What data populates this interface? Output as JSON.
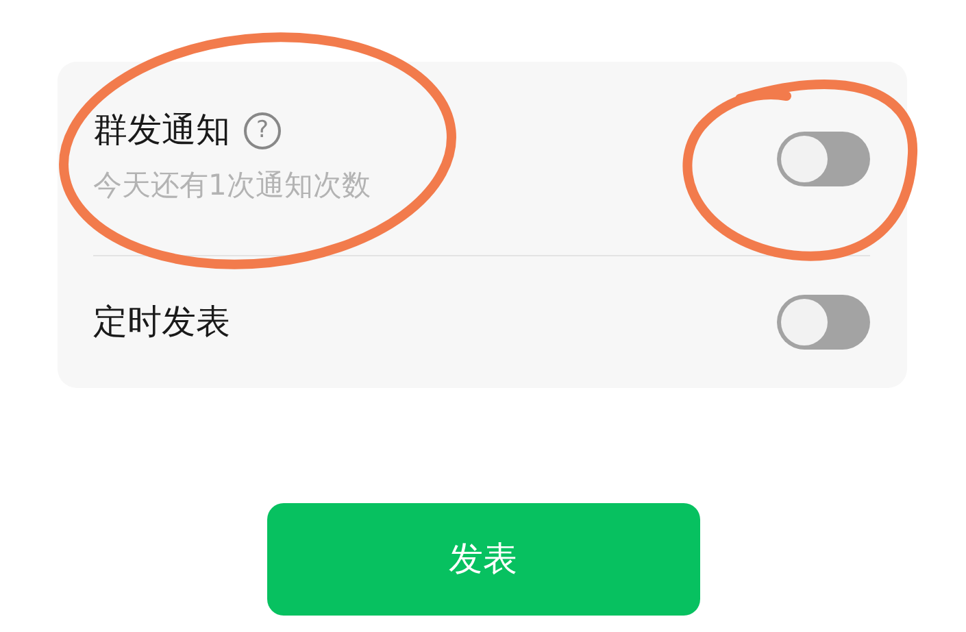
{
  "settings": [
    {
      "kind": "help",
      "label": "群发通知",
      "help_icon": "?",
      "subtitle": "今天还有1次通知次数",
      "on": false
    },
    {
      "kind": "plain",
      "label": "定时发表",
      "on": false
    }
  ],
  "publish_button": "发表"
}
